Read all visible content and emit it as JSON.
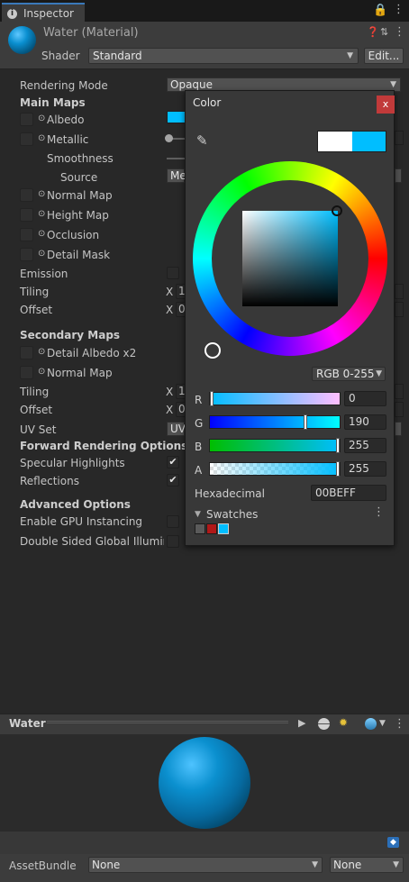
{
  "tab": {
    "title": "Inspector"
  },
  "header": {
    "material_name": "Water (Material)",
    "shader_label": "Shader",
    "shader_value": "Standard",
    "edit_label": "Edit..."
  },
  "rows": {
    "rendering_mode": {
      "label": "Rendering Mode",
      "value": "Opaque"
    },
    "main_maps": "Main Maps",
    "albedo": "Albedo",
    "metallic": "Metallic",
    "smoothness": "Smoothness",
    "source": {
      "label": "Source",
      "value": "Me"
    },
    "normal_map": "Normal Map",
    "height_map": "Height Map",
    "occlusion": "Occlusion",
    "detail_mask": "Detail Mask",
    "emission": "Emission",
    "tiling": {
      "label": "Tiling",
      "x": "X",
      "xv": "1"
    },
    "offset": {
      "label": "Offset",
      "x": "X",
      "xv": "0"
    },
    "secondary_maps": "Secondary Maps",
    "detail_albedo": "Detail Albedo x2",
    "normal_map2": "Normal Map",
    "tiling2": {
      "label": "Tiling",
      "x": "X",
      "xv": "1"
    },
    "offset2": {
      "label": "Offset",
      "x": "X",
      "xv": "0"
    },
    "uv_set": {
      "label": "UV Set",
      "value": "UV"
    },
    "forward_options": "Forward Rendering Options",
    "specular": "Specular Highlights",
    "reflections": "Reflections",
    "advanced": "Advanced Options",
    "gpu_instancing": "Enable GPU Instancing",
    "double_sided": "Double Sided Global Illumina"
  },
  "picker": {
    "title": "Color",
    "close": "x",
    "mode": "RGB 0-255",
    "channels": [
      {
        "label": "R",
        "value": "0",
        "level": 0
      },
      {
        "label": "G",
        "value": "190",
        "level": 0.745
      },
      {
        "label": "B",
        "value": "255",
        "level": 1
      },
      {
        "label": "A",
        "value": "255",
        "level": 1
      }
    ],
    "hex_label": "Hexadecimal",
    "hex_value": "00BEFF",
    "swatches_label": "Swatches",
    "color": "#00BEFF",
    "swatch_colors": [
      "#5a5a5a",
      "#b01818",
      "#00beff"
    ]
  },
  "preview": {
    "title": "Water"
  },
  "assetbundle": {
    "label": "AssetBundle",
    "value1": "None",
    "value2": "None"
  },
  "icons": [
    "info-icon",
    "menu-icon",
    "lock-icon",
    "help-icon",
    "settings-icon",
    "eyedropper-icon",
    "play-icon",
    "sphere-icon",
    "light-icon",
    "tag-icon"
  ]
}
